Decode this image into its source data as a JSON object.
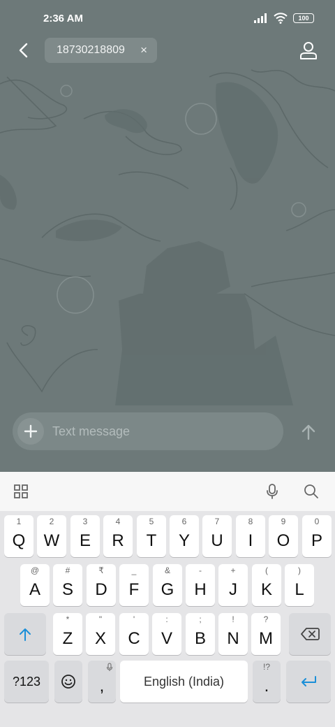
{
  "status_bar": {
    "time": "2:36 AM",
    "battery": "100",
    "icons": [
      "signal-icon",
      "wifi-icon",
      "battery-icon"
    ]
  },
  "top_bar": {
    "recipient": "18730218809",
    "chip_close": "×"
  },
  "composer": {
    "placeholder": "Text message",
    "add_icon": "plus-icon",
    "send_icon": "arrow-up-icon"
  },
  "keyboard": {
    "toolbar_icons": [
      "grid-icon",
      "mic-icon",
      "search-icon"
    ],
    "row1": [
      {
        "hint": "1",
        "label": "Q"
      },
      {
        "hint": "2",
        "label": "W"
      },
      {
        "hint": "3",
        "label": "E"
      },
      {
        "hint": "4",
        "label": "R"
      },
      {
        "hint": "5",
        "label": "T"
      },
      {
        "hint": "6",
        "label": "Y"
      },
      {
        "hint": "7",
        "label": "U"
      },
      {
        "hint": "8",
        "label": "I"
      },
      {
        "hint": "9",
        "label": "O"
      },
      {
        "hint": "0",
        "label": "P"
      }
    ],
    "row2": [
      {
        "hint": "@",
        "label": "A"
      },
      {
        "hint": "#",
        "label": "S"
      },
      {
        "hint": "₹",
        "label": "D"
      },
      {
        "hint": "_",
        "label": "F"
      },
      {
        "hint": "&",
        "label": "G"
      },
      {
        "hint": "-",
        "label": "H"
      },
      {
        "hint": "+",
        "label": "J"
      },
      {
        "hint": "(",
        "label": "K"
      },
      {
        "hint": ")",
        "label": "L"
      }
    ],
    "row3": [
      {
        "hint": "*",
        "label": "Z"
      },
      {
        "hint": "\"",
        "label": "X"
      },
      {
        "hint": "'",
        "label": "C"
      },
      {
        "hint": ":",
        "label": "V"
      },
      {
        "hint": ";",
        "label": "B"
      },
      {
        "hint": "!",
        "label": "N"
      },
      {
        "hint": "?",
        "label": "M"
      }
    ],
    "symbols_key": "?123",
    "comma_key": ",",
    "space_label": "English (India)",
    "period_hint": "!?",
    "period_key": "."
  },
  "colors": {
    "accent": "#1a8fd8",
    "wallpaper": "#6d7979",
    "keyboard_bg": "#e5e5e7"
  }
}
